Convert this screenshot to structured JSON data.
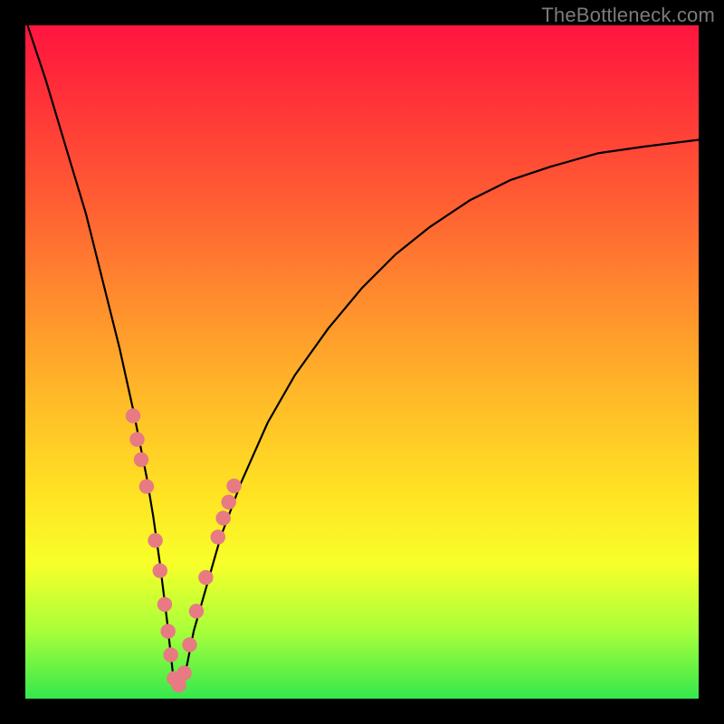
{
  "watermark": {
    "text": "TheBottleneck.com"
  },
  "colors": {
    "marker_fill": "#e77a82",
    "curve_stroke": "#000000",
    "gradient_top": "#ff153f",
    "gradient_bottom": "#34e84d",
    "frame": "#000000",
    "watermark": "#7b7b7b"
  },
  "chart_data": {
    "type": "line",
    "title": "",
    "xlabel": "",
    "ylabel": "",
    "xlim": [
      0,
      100
    ],
    "ylim": [
      0,
      100
    ],
    "grid": false,
    "legend": false,
    "notes": "Single black V-shaped curve on a red→yellow→green vertical gradient. Left branch steep/near-vertical from top-left corner, minimum near x≈22 y≈0, right branch rises with decreasing slope toward upper-right. Salmon circular markers cluster along the curve near the trough on both branches. Values are estimated from pixel positions; no axis ticks or numeric labels are rendered.",
    "series": [
      {
        "name": "bottleneck-curve",
        "x": [
          0,
          3,
          6,
          9,
          12,
          14,
          16,
          18,
          19,
          20,
          21,
          22,
          23,
          24,
          25,
          27,
          29,
          32,
          36,
          40,
          45,
          50,
          55,
          60,
          66,
          72,
          78,
          85,
          92,
          100
        ],
        "y": [
          101,
          92,
          82,
          72,
          60,
          52,
          43,
          33,
          27,
          20,
          12,
          3,
          2,
          5,
          10,
          17,
          24,
          32,
          41,
          48,
          55,
          61,
          66,
          70,
          74,
          77,
          79,
          81,
          82,
          83
        ]
      }
    ],
    "markers": {
      "name": "highlight-points",
      "color": "#e77a82",
      "radius_pct": 1.1,
      "points": [
        {
          "x": 16.0,
          "y": 42.0
        },
        {
          "x": 16.6,
          "y": 38.5
        },
        {
          "x": 17.2,
          "y": 35.5
        },
        {
          "x": 18.0,
          "y": 31.5
        },
        {
          "x": 19.3,
          "y": 23.5
        },
        {
          "x": 20.0,
          "y": 19.0
        },
        {
          "x": 20.7,
          "y": 14.0
        },
        {
          "x": 21.2,
          "y": 10.0
        },
        {
          "x": 21.6,
          "y": 6.5
        },
        {
          "x": 22.1,
          "y": 3.0
        },
        {
          "x": 22.8,
          "y": 2.0
        },
        {
          "x": 23.6,
          "y": 3.8
        },
        {
          "x": 24.4,
          "y": 8.0
        },
        {
          "x": 25.4,
          "y": 13.0
        },
        {
          "x": 26.8,
          "y": 18.0
        },
        {
          "x": 28.6,
          "y": 24.0
        },
        {
          "x": 29.4,
          "y": 26.8
        },
        {
          "x": 30.2,
          "y": 29.2
        },
        {
          "x": 31.0,
          "y": 31.6
        }
      ]
    }
  }
}
